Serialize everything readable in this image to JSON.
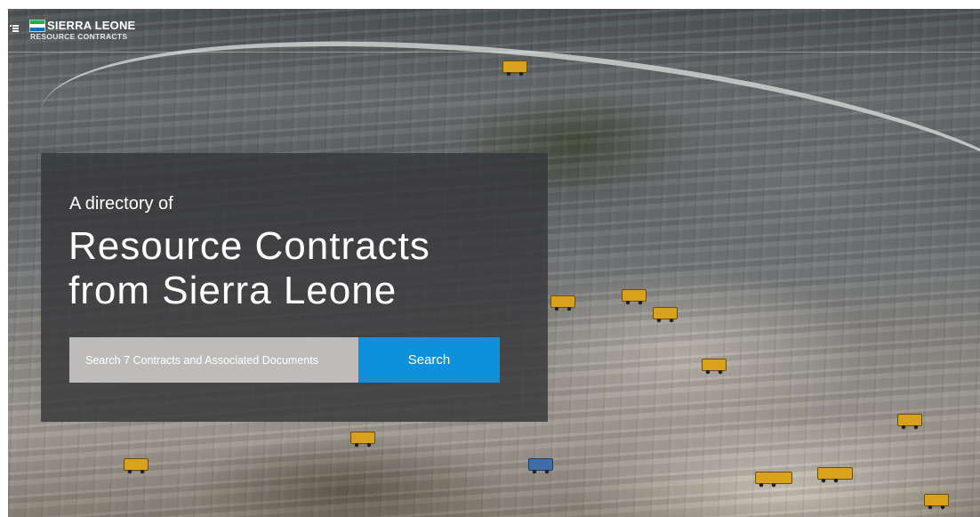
{
  "header": {
    "menu_icon": "menu-icon",
    "flag_icon": "sierra-leone-flag-icon",
    "brand_title": "SIERRA LEONE",
    "brand_subtitle": "RESOURCE CONTRACTS"
  },
  "hero": {
    "intro": "A directory of",
    "headline_line1": "Resource Contracts",
    "headline_line2": "from Sierra Leone"
  },
  "search": {
    "placeholder": "Search 7 Contracts and Associated Documents",
    "value": "",
    "button_label": "Search"
  },
  "colors": {
    "accent": "#0f90db",
    "panel": "#373739",
    "flag_green": "#1eb53a",
    "flag_white": "#ffffff",
    "flag_blue": "#0072c6"
  }
}
